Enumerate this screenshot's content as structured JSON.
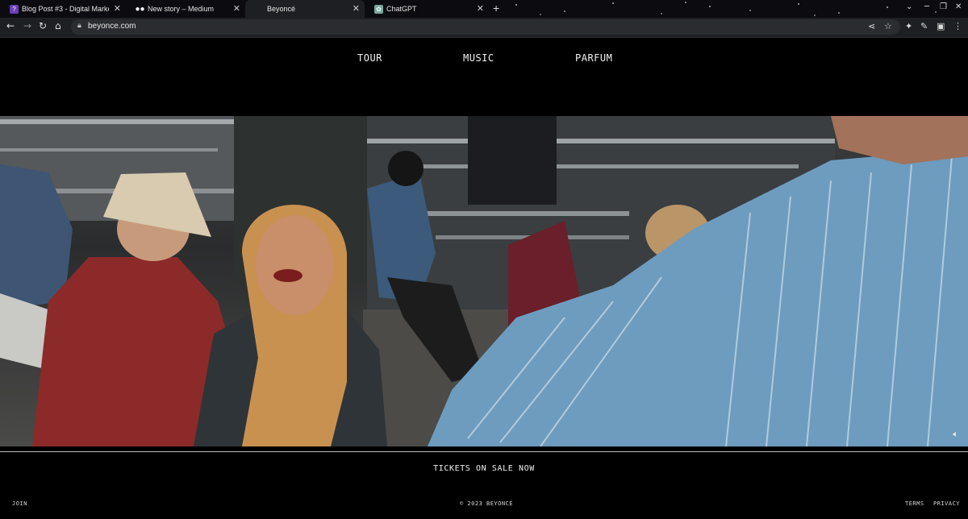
{
  "browser": {
    "tabs": [
      {
        "title": "Blog Post #3 - Digital Marketing",
        "favicon": "purple-square-icon",
        "color": "#6a3fb5"
      },
      {
        "title": "New story – Medium",
        "favicon": "medium-dots-icon",
        "color": "#000000"
      },
      {
        "title": "Beyoncé",
        "favicon": "blank-icon",
        "color": "#1e1f22"
      },
      {
        "title": "ChatGPT",
        "favicon": "chatgpt-icon",
        "color": "#74aa9c"
      }
    ],
    "new_tab": "+",
    "url": "beyonce.com"
  },
  "nav": {
    "items": [
      "TOUR",
      "MUSIC",
      "PARFUM"
    ]
  },
  "hero": {
    "media": "video-still-backstage-arena",
    "mute_icon": "speaker-mute-icon"
  },
  "tickets": {
    "label": "TICKETS ON SALE NOW"
  },
  "footer": {
    "join": "JOIN",
    "copyright": "© 2023 BEYONCÉ",
    "terms": "TERMS",
    "privacy": "PRIVACY"
  },
  "colors": {
    "background": "#000000",
    "text": "#ffffff",
    "divider": "#bdbdbd"
  }
}
